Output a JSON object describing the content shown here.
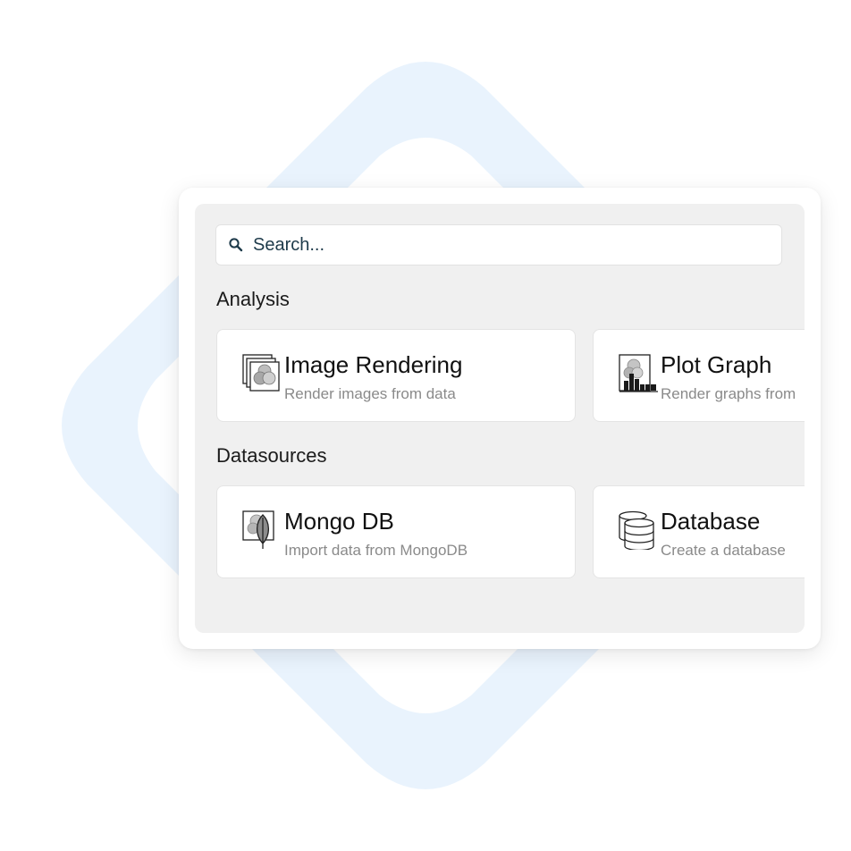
{
  "search": {
    "placeholder": "Search..."
  },
  "sections": [
    {
      "title": "Analysis",
      "items": [
        {
          "icon": "image-rendering-icon",
          "title": "Image Rendering",
          "description": "Render images from data"
        },
        {
          "icon": "plot-graph-icon",
          "title": "Plot Graph",
          "description": "Render graphs from"
        }
      ]
    },
    {
      "title": "Datasources",
      "items": [
        {
          "icon": "mongodb-leaf-icon",
          "title": "Mongo DB",
          "description": "Import data from MongoDB"
        },
        {
          "icon": "database-icon",
          "title": "Database",
          "description": "Create a database"
        }
      ]
    }
  ],
  "colors": {
    "background_shape": "#e9f3fd",
    "panel": "#f0f0f0",
    "card": "#ffffff",
    "title_text": "#111111",
    "description_text": "#8a8a8a",
    "search_text": "#1d3a4a"
  }
}
